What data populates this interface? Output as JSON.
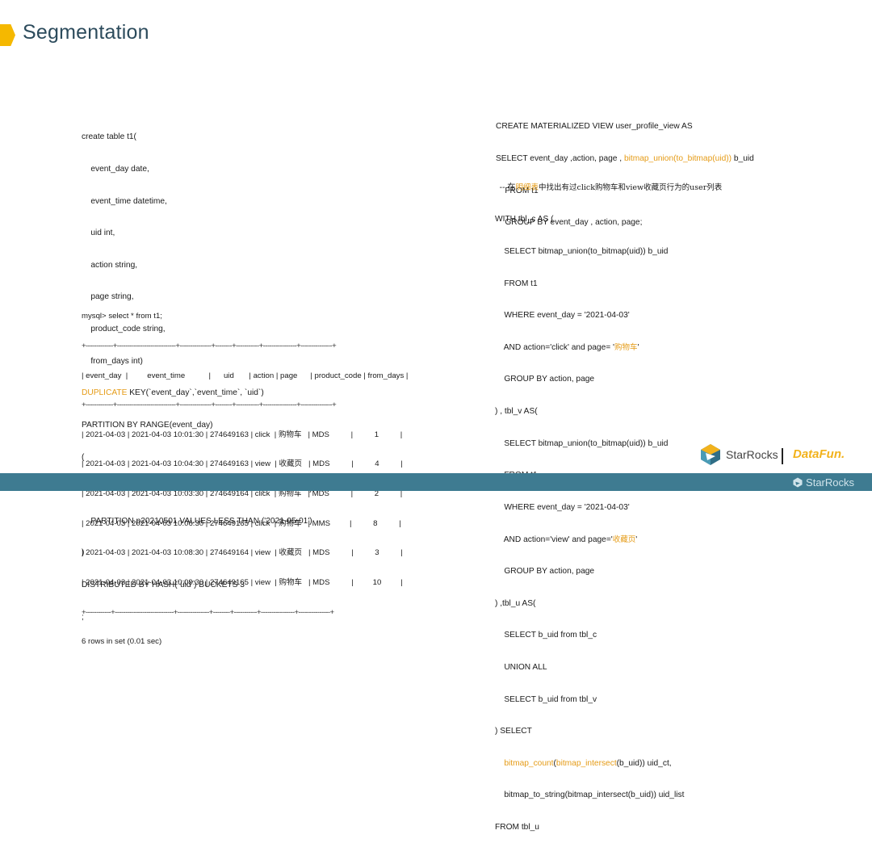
{
  "slide": {
    "title": "Segmentation"
  },
  "left": {
    "create_table": [
      "create table t1(",
      "    event_day date,",
      "    event_time datetime,",
      "    uid int,",
      "    action string,",
      "    page string,",
      "    product_code string,",
      "    from_days int)"
    ],
    "duplicate_kw": "DUPLICATE",
    "duplicate_rest": " KEY(`event_day`,`event_time`, `uid`)",
    "partition_lines": [
      "PARTITION BY RANGE(event_day)",
      "(",
      "    PARTITION p20210401 VALUES LESS THAN ('2021-04-01'),",
      "    PARTITION p20210501 VALUES LESS THAN ('2021-05-01')",
      ")",
      "DISTRIBUTED BY HASH(`uid`) BUCKETS 3",
      ";"
    ],
    "query": "mysql> select * from t1;",
    "border": "+-------------+----------------------------+---------------+--------+-----------+----------------+---------------+",
    "header": "| event_day  |         event_time           |      uid       | action | page      | product_code | from_days |",
    "rows": [
      {
        "pre": "| 2021-04-03 | 2021-04-03 10:01:30 | 274649163 | click  | ",
        "cn": "购物车",
        "post": "   | MDS          |          1          |"
      },
      {
        "pre": "| 2021-04-03 | 2021-04-03 10:04:30 | 274649163 | view  | ",
        "cn": "收藏页",
        "post": "   | MDS          |          4          |"
      },
      {
        "pre": "| 2021-04-03 | 2021-04-03 10:03:30 | 274649164 | click  | ",
        "cn": "购物车",
        "post": "   | MDS          |          2          |"
      },
      {
        "pre": "| 2021-04-03 | 2021-04-03 10:06:30 | 274649165 | click  | ",
        "cn": "购物车",
        "post": "   | MMS         |          8          |"
      },
      {
        "pre": "| 2021-04-03 | 2021-04-03 10:08:30 | 274649164 | view  | ",
        "cn": "收藏页",
        "post": "   | MDS          |          3          |"
      },
      {
        "pre": "| 2021-04-03 | 2021-04-03 10:09:30 | 274649165 | view  | ",
        "cn": "购物车",
        "post": "   | MDS          |         10         |"
      }
    ],
    "footer_border": "+------------+----------------------------+---------------+--------+-----------+----------------+---------------+",
    "result": "6 rows in set (0.01 sec)"
  },
  "right": {
    "mv_line1": "CREATE MATERIALIZED VIEW user_profile_view AS",
    "mv_line2_pre": "SELECT event_day ,action, page , ",
    "mv_line2_hl": "bitmap_union(to_bitmap(uid))",
    "mv_line2_post": " b_uid",
    "mv_line3": "    FROM t1",
    "mv_line4": "    GROUP BY event_day , action, page;",
    "comment_pre": "-- 在",
    "comment_hl": "明细表",
    "comment_post": "中找出有过click购物车和view收藏页行为的user列表",
    "cte": [
      "WITH tbl_c AS (",
      "    SELECT bitmap_union(to_bitmap(uid)) b_uid",
      "    FROM t1",
      "    WHERE event_day = '2021-04-03'"
    ],
    "cte_and1_pre": "    AND action='click' and page= '",
    "cte_and1_hl": "购物车",
    "cte_and1_post": "'",
    "cte2": [
      "    GROUP BY action, page",
      ") , tbl_v AS(",
      "    SELECT bitmap_union(to_bitmap(uid)) b_uid",
      "    FROM t1",
      "    WHERE event_day = '2021-04-03'"
    ],
    "cte_and2_pre": "    AND action='view' and page='",
    "cte_and2_hl": "收藏页",
    "cte_and2_post": "'",
    "cte3": [
      "    GROUP BY action, page",
      ") ,tbl_u AS(",
      "    SELECT b_uid from tbl_c",
      "    UNION ALL",
      "    SELECT b_uid from tbl_v",
      ") SELECT"
    ],
    "sel1_indent": "    ",
    "sel1_hl1": "bitmap_count",
    "sel1_mid": "(",
    "sel1_hl2": "bitmap_intersect",
    "sel1_post": "(b_uid)) uid_ct,",
    "sel2": "    bitmap_to_string(bitmap_intersect(b_uid)) uid_list",
    "sel3": "FROM tbl_u"
  },
  "branding": {
    "starrocks": "StarRocks",
    "datafun": "DataFun.",
    "footer": "StarRocks"
  },
  "colors": {
    "accent": "#f5b800",
    "highlight": "#e59b16",
    "footer": "#3e7b91",
    "title": "#2c4b5c"
  }
}
